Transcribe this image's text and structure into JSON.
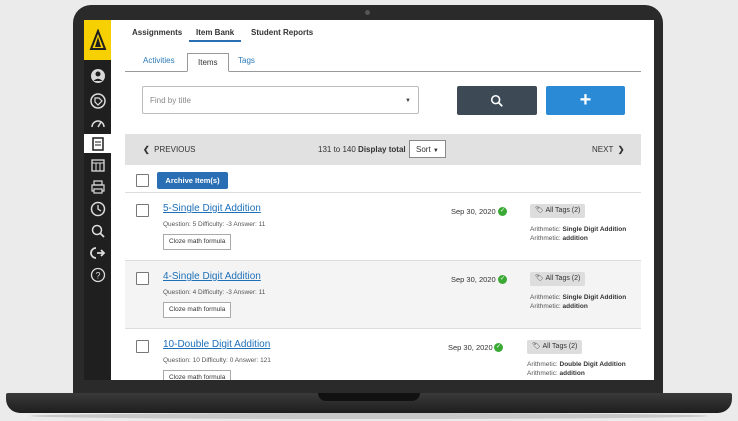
{
  "top_nav": {
    "assignments": "Assignments",
    "item_bank": "Item Bank",
    "student_reports": "Student Reports"
  },
  "sub_tabs": {
    "activities": "Activities",
    "items": "Items",
    "tags": "Tags"
  },
  "search": {
    "placeholder": "Find by title"
  },
  "add_label": "+",
  "pager": {
    "previous": "PREVIOUS",
    "range": "131 to 140",
    "display_total": "Display total",
    "sort": "Sort",
    "next": "NEXT"
  },
  "archive_label": "Archive Item(s)",
  "items": [
    {
      "title": "5-Single Digit Addition",
      "meta": "Question: 5  Difficulty: -3  Answer: 11",
      "chip": "Cloze math formula",
      "date": "Sep 30, 2020",
      "tags_label": "All Tags (2)",
      "tag1_key": "Arithmetic:",
      "tag1_val": "Single Digit Addition",
      "tag2_key": "Arithmetic:",
      "tag2_val": "addition"
    },
    {
      "title": "4-Single Digit Addition",
      "meta": "Question: 4  Difficulty: -3  Answer: 11",
      "chip": "Cloze math formula",
      "date": "Sep 30, 2020",
      "tags_label": "All Tags (2)",
      "tag1_key": "Arithmetic:",
      "tag1_val": "Single Digit Addition",
      "tag2_key": "Arithmetic:",
      "tag2_val": "addition"
    },
    {
      "title": "10-Double Digit Addition",
      "meta": "Question: 10  Difficulty: 0  Answer: 121",
      "chip": "Cloze math formula",
      "date": "Sep 30, 2020",
      "tags_label": "All Tags (2)",
      "tag1_key": "Arithmetic:",
      "tag1_val": "Double Digit Addition",
      "tag2_key": "Arithmetic:",
      "tag2_val": "addition"
    }
  ],
  "colors": {
    "brand_yellow": "#f6d000",
    "primary_blue": "#2a6fb3",
    "add_blue": "#2a8ad6",
    "search_dark": "#3d4a55",
    "ok_green": "#3aaa35"
  },
  "icons": [
    "logo-icon",
    "user-icon",
    "tag-icon",
    "dashboard-icon",
    "items-icon",
    "calendar-icon",
    "print-icon",
    "clock-icon",
    "search-icon",
    "logout-icon",
    "help-icon"
  ]
}
